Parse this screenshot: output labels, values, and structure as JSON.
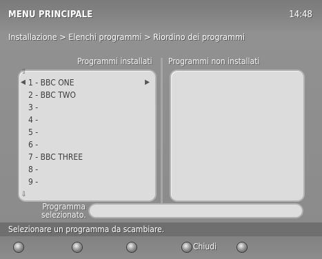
{
  "header": {
    "title": "MENU PRINCIPALE",
    "clock": "14:48"
  },
  "breadcrumb": "Installazione > Elenchi programmi > Riordino dei programmi",
  "installed": {
    "heading": "Programmi installati",
    "items": [
      {
        "label": "1 - BBC ONE",
        "selected": true
      },
      {
        "label": "2 - BBC TWO"
      },
      {
        "label": "3 -"
      },
      {
        "label": "4 -"
      },
      {
        "label": "5 -"
      },
      {
        "label": "6 -"
      },
      {
        "label": "7 - BBC THREE"
      },
      {
        "label": "8 -"
      },
      {
        "label": "9 -"
      }
    ]
  },
  "not_installed": {
    "heading": "Programmi non installati",
    "items": []
  },
  "selected_program": {
    "label_line1": "Programma",
    "label_line2": "selezionato.",
    "value": ""
  },
  "status": "Selezionare un programma da scambiare.",
  "softkeys": [
    {
      "label": ""
    },
    {
      "label": ""
    },
    {
      "label": ""
    },
    {
      "label": "Chiudi"
    },
    {
      "label": ""
    }
  ],
  "colors": {
    "background": "#8d8d8d",
    "panel": "#dcdcdc",
    "status_bar": "#6f6f6f"
  }
}
